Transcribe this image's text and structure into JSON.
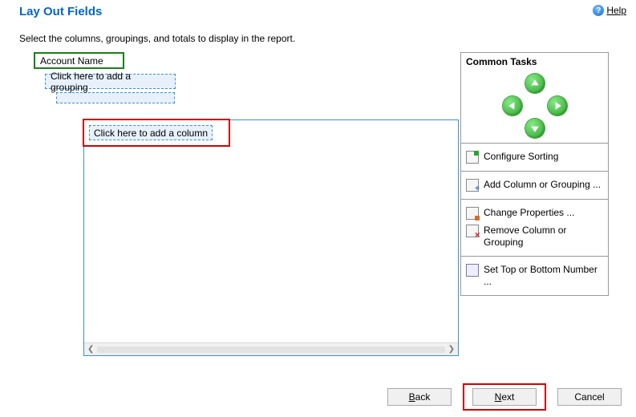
{
  "header": {
    "title": "Lay Out Fields",
    "help_label": "Help"
  },
  "instructions": "Select the columns, groupings, and totals to display in the report.",
  "layout": {
    "account_name": "Account Name",
    "add_grouping": "Click here to add a grouping",
    "add_column": "Click here to add a column"
  },
  "tasks": {
    "title": "Common Tasks",
    "configure_sorting": "Configure Sorting",
    "add_column_grouping": "Add Column or Grouping ...",
    "change_properties": "Change Properties ...",
    "remove_column_grouping": "Remove Column or Grouping",
    "set_top_bottom": "Set Top or Bottom Number ..."
  },
  "buttons": {
    "back": "Back",
    "next": "Next",
    "cancel": "Cancel"
  }
}
